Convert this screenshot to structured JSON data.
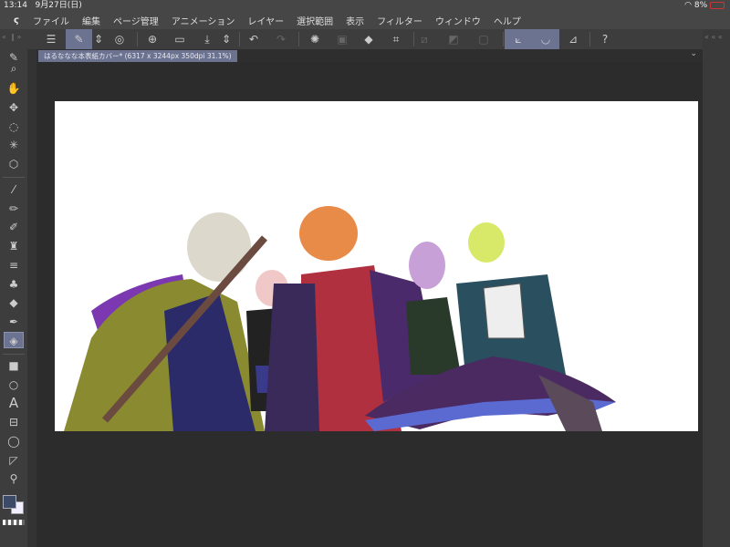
{
  "status": {
    "time": "13:14",
    "date": "9月27日(日)",
    "battery": "8%"
  },
  "menu": [
    "ファイル",
    "編集",
    "ページ管理",
    "アニメーション",
    "レイヤー",
    "選択範囲",
    "表示",
    "フィルター",
    "ウィンドウ",
    "ヘルプ"
  ],
  "document_tab": {
    "title": "はるななな本表紙カバー* (6317 x 3244px 350dpi 31.1%)"
  },
  "icons": {
    "toolbar": [
      "menu",
      "tool-property",
      "stepper",
      "companion",
      "new",
      "open",
      "save",
      "stepper",
      "undo",
      "redo",
      "clear-selection",
      "copy-paste",
      "fill",
      "crop",
      "deselect",
      "invert-selection",
      "show-selection",
      "snap-ruler",
      "snap-special-ruler",
      "stabilization",
      "help"
    ]
  },
  "colors": {
    "accent": "#6b7391",
    "main_color": "#3b4a66",
    "sub_color": "#f0eeff"
  }
}
